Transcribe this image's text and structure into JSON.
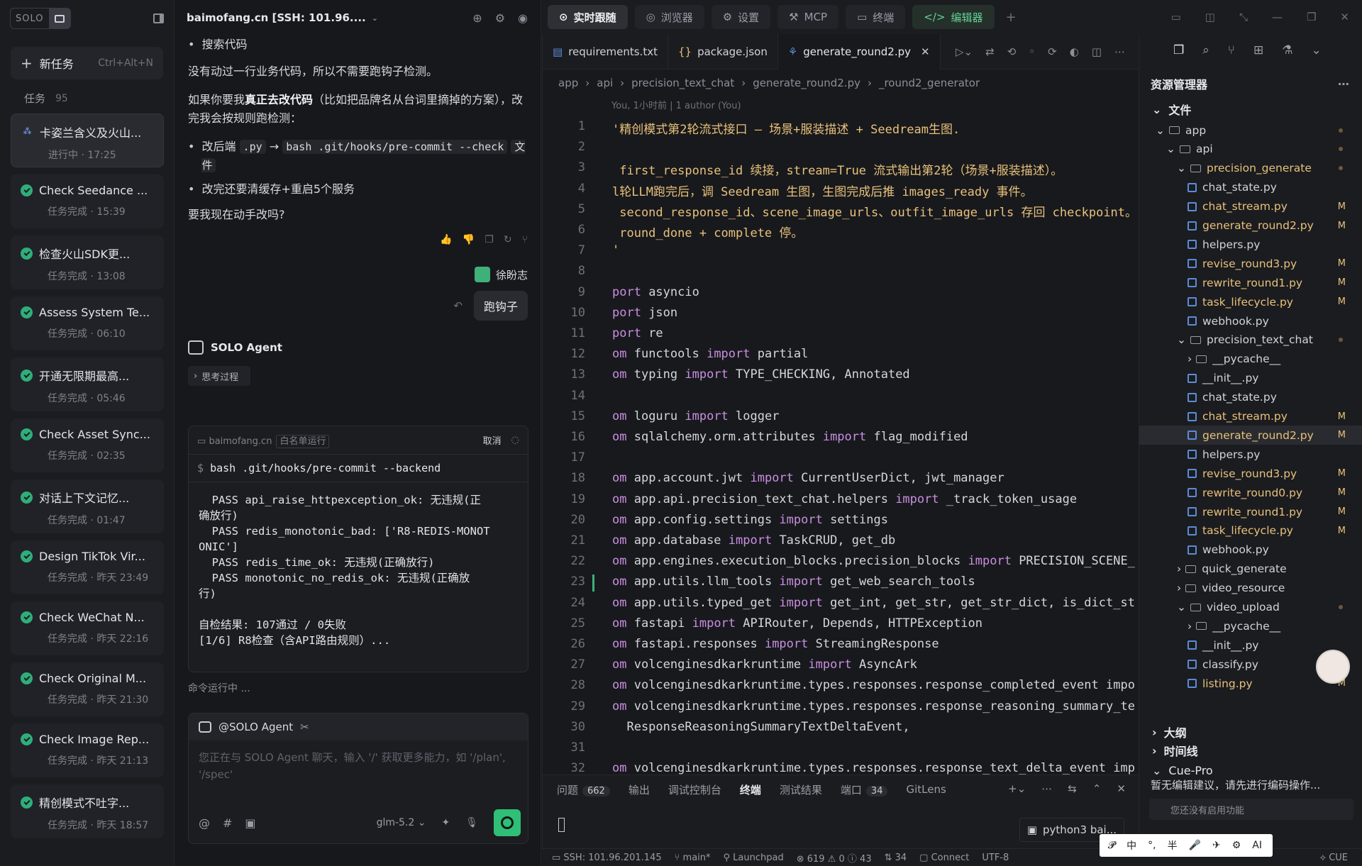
{
  "sidebar": {
    "logo_text": "SOLO",
    "new_task": "新任务",
    "new_task_shortcut": "Ctrl+Alt+N",
    "tasks_label": "任务",
    "tasks_count": "95",
    "items": [
      {
        "title": "卡姿兰含义及火山...",
        "status": "进行中 · 17:25",
        "state": "running"
      },
      {
        "title": "Check Seedance ...",
        "status": "任务完成 · 15:39",
        "state": "done"
      },
      {
        "title": "检查火山SDK更...",
        "status": "任务完成 · 13:08",
        "state": "done"
      },
      {
        "title": "Assess System Te...",
        "status": "任务完成 · 06:10",
        "state": "done"
      },
      {
        "title": "开通无限期最高...",
        "status": "任务完成 · 05:46",
        "state": "done"
      },
      {
        "title": "Check Asset Sync...",
        "status": "任务完成 · 02:35",
        "state": "done"
      },
      {
        "title": "对话上下文记忆...",
        "status": "任务完成 · 01:47",
        "state": "done"
      },
      {
        "title": "Design TikTok Vir...",
        "status": "任务完成 · 昨天 23:49",
        "state": "done"
      },
      {
        "title": "Check WeChat N...",
        "status": "任务完成 · 昨天 22:16",
        "state": "done"
      },
      {
        "title": "Check Original M...",
        "status": "任务完成 · 昨天 21:30",
        "state": "done"
      },
      {
        "title": "Check Image Rep...",
        "status": "任务完成 · 昨天 21:13",
        "state": "done"
      },
      {
        "title": "精创模式不吐字...",
        "status": "任务完成 · 昨天 18:57",
        "state": "done"
      }
    ]
  },
  "chat": {
    "header": "baimofang.cn [SSH: 101.96....",
    "bullet_search": "搜索代码",
    "p1": "没有动过一行业务代码，所以不需要跑钩子检测。",
    "p2a": "如果你要我",
    "p2b": "真正去改代码",
    "p2c": "（比如把品牌名从台词里摘掉的方案），改完我会按规则跑检测：",
    "b1a": "改后端",
    "b1code1": ".py",
    "b1arrow": "→",
    "b1code2": "bash .git/hooks/pre-commit --check",
    "b1b": "文件",
    "b2": "改完还要清缓存+重启5个服务",
    "p3": "要我现在动手改吗?",
    "user_name": "徐盼志",
    "user_msg": "跑钩子",
    "agent_name": "SOLO Agent",
    "think": "思考过程",
    "term_host": "baimofang.cn",
    "term_pill": "白名单运行",
    "term_cancel": "取消",
    "term_cmd": "bash .git/hooks/pre-commit --backend",
    "term_output": "  PASS api_raise_httpexception_ok: 无违规(正\n确放行)\n  PASS redis_monotonic_bad: ['R8-REDIS-MONOT\nONIC']\n  PASS redis_time_ok: 无违规(正确放行)\n  PASS monotonic_no_redis_ok: 无违规(正确放\n行)\n\n自检结果: 107通过 / 0失败\n[1/6] R8检查（含API路由规则）...",
    "running": "命令运行中 ...",
    "input_header": "@SOLO Agent",
    "input_placeholder": "您正在与 SOLO Agent 聊天，输入 '/' 获取更多能力，如 '/plan', '/spec'",
    "model": "glm-5.2"
  },
  "topbar": {
    "tabs": [
      "实时跟随",
      "浏览器",
      "设置",
      "MCP",
      "终端",
      "编辑器"
    ]
  },
  "editor": {
    "file_tabs": [
      "requirements.txt",
      "package.json",
      "generate_round2.py"
    ],
    "breadcrumb": [
      "app",
      "api",
      "precision_text_chat",
      "generate_round2.py",
      "_round2_generator"
    ],
    "blame": "You, 1小时前 | 1 author (You)",
    "lines": [
      "'精创模式第2轮流式接口 — 场景+服装描述 + Seedream生图.",
      "",
      " first_response_id 续接，stream=True 流式输出第2轮（场景+服装描述）。",
      "l轮LLM跑完后，调 Seedream 生图，生图完成后推 images_ready 事件。",
      " second_response_id、scene_image_urls、outfit_image_urls 存回 checkpoint。",
      " round_done + complete 停。",
      "'",
      "",
      "port asyncio",
      "port json",
      "port re",
      "om functools import partial",
      "om typing import TYPE_CHECKING, Annotated",
      "",
      "om loguru import logger",
      "om sqlalchemy.orm.attributes import flag_modified",
      "",
      "om app.account.jwt import CurrentUserDict, jwt_manager",
      "om app.api.precision_text_chat.helpers import _track_token_usage",
      "om app.config.settings import settings",
      "om app.database import TaskCRUD, get_db",
      "om app.engines.execution_blocks.precision_blocks import PRECISION_SCENE_",
      "om app.utils.llm_tools import get_web_search_tools",
      "om app.utils.typed_get import get_int, get_str, get_str_dict, is_dict_st",
      "om fastapi import APIRouter, Depends, HTTPException",
      "om fastapi.responses import StreamingResponse",
      "om volcenginesdkarkruntime import AsyncArk",
      "om volcenginesdkarkruntime.types.responses.response_completed_event impo",
      "om volcenginesdkarkruntime.types.responses.response_reasoning_summary_te",
      "  ResponseReasoningSummaryTextDeltaEvent,",
      "",
      "om volcenginesdkarkruntime.types.responses.response_text_delta_event imp"
    ],
    "panel_tabs": [
      {
        "label": "问题",
        "badge": "662"
      },
      {
        "label": "输出",
        "badge": ""
      },
      {
        "label": "调试控制台",
        "badge": ""
      },
      {
        "label": "终端",
        "badge": ""
      },
      {
        "label": "测试结果",
        "badge": ""
      },
      {
        "label": "端口",
        "badge": "34"
      },
      {
        "label": "GitLens",
        "badge": ""
      }
    ],
    "python_term": "python3 bai..."
  },
  "explorer": {
    "title": "资源管理器",
    "files_section": "文件",
    "tree": [
      {
        "name": "app",
        "type": "folder",
        "depth": 1,
        "open": true,
        "dot": true
      },
      {
        "name": "api",
        "type": "folder",
        "depth": 2,
        "open": true,
        "dot": true
      },
      {
        "name": "precision_generate",
        "type": "folder",
        "depth": 3,
        "open": true,
        "dot": true,
        "mod": true
      },
      {
        "name": "chat_state.py",
        "type": "py",
        "depth": 4
      },
      {
        "name": "chat_stream.py",
        "type": "py",
        "depth": 4,
        "m": "M"
      },
      {
        "name": "generate_round2.py",
        "type": "py",
        "depth": 4,
        "m": "M"
      },
      {
        "name": "helpers.py",
        "type": "py",
        "depth": 4
      },
      {
        "name": "revise_round3.py",
        "type": "py",
        "depth": 4,
        "m": "M"
      },
      {
        "name": "rewrite_round1.py",
        "type": "py",
        "depth": 4,
        "m": "M"
      },
      {
        "name": "task_lifecycle.py",
        "type": "py",
        "depth": 4,
        "m": "M"
      },
      {
        "name": "webhook.py",
        "type": "py",
        "depth": 4
      },
      {
        "name": "precision_text_chat",
        "type": "folder",
        "depth": 3,
        "open": true,
        "dot": true
      },
      {
        "name": "__pycache__",
        "type": "folder",
        "depth": 4
      },
      {
        "name": "__init__.py",
        "type": "py",
        "depth": 4
      },
      {
        "name": "chat_state.py",
        "type": "py",
        "depth": 4
      },
      {
        "name": "chat_stream.py",
        "type": "py",
        "depth": 4,
        "m": "M"
      },
      {
        "name": "generate_round2.py",
        "type": "py",
        "depth": 4,
        "m": "M",
        "sel": true
      },
      {
        "name": "helpers.py",
        "type": "py",
        "depth": 4
      },
      {
        "name": "revise_round3.py",
        "type": "py",
        "depth": 4,
        "m": "M"
      },
      {
        "name": "rewrite_round0.py",
        "type": "py",
        "depth": 4,
        "m": "M"
      },
      {
        "name": "rewrite_round1.py",
        "type": "py",
        "depth": 4,
        "m": "M"
      },
      {
        "name": "task_lifecycle.py",
        "type": "py",
        "depth": 4,
        "m": "M"
      },
      {
        "name": "webhook.py",
        "type": "py",
        "depth": 4
      },
      {
        "name": "quick_generate",
        "type": "folder",
        "depth": 3
      },
      {
        "name": "video_resource",
        "type": "folder",
        "depth": 3
      },
      {
        "name": "video_upload",
        "type": "folder",
        "depth": 3,
        "open": true,
        "dot": true
      },
      {
        "name": "__pycache__",
        "type": "folder",
        "depth": 4
      },
      {
        "name": "__init__.py",
        "type": "py",
        "depth": 4
      },
      {
        "name": "classify.py",
        "type": "py",
        "depth": 4
      },
      {
        "name": "listing.py",
        "type": "py",
        "depth": 4,
        "m": "M"
      }
    ],
    "outline": "大纲",
    "timeline": "时间线",
    "cue_title": "Cue-Pro",
    "cue_text": "暂无编辑建议，请先进行编码操作...",
    "cue_link": "您还没有启用功能"
  },
  "status": {
    "ssh": "SSH: 101.96.201.145",
    "branch": "main*",
    "launchpad": "Launchpad",
    "errors": "619",
    "warnings": "0",
    "infos": "43",
    "ports": "34",
    "connect": "Connect",
    "encoding": "UTF-8",
    "cue": "CUE"
  },
  "ime": {
    "keys": [
      "中",
      "°,",
      "半",
      "🎤",
      "✈",
      "⚙",
      "AI"
    ]
  },
  "colors": {
    "accent_green": "#2fbf76",
    "modified": "#e7c17a",
    "bg": "#17181c"
  }
}
